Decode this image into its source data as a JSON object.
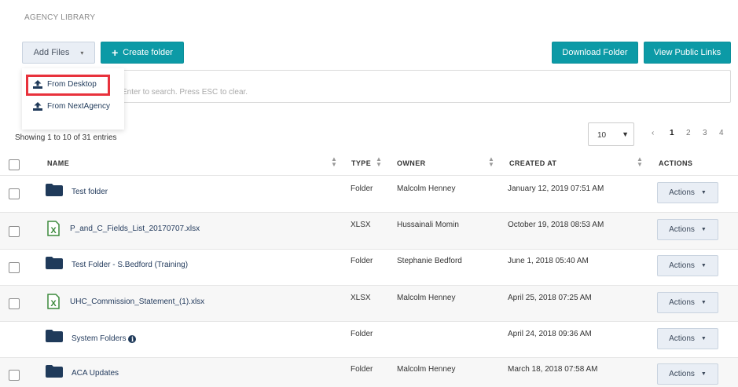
{
  "header": {
    "title": "AGENCY LIBRARY"
  },
  "toolbar": {
    "add_files_label": "Add Files",
    "create_folder_label": "Create folder",
    "download_folder_label": "Download Folder",
    "view_public_links_label": "View Public Links"
  },
  "add_files_menu": {
    "items": [
      {
        "label": "From Desktop",
        "icon": "upload-icon"
      },
      {
        "label": "From NextAgency",
        "icon": "upload-icon"
      }
    ]
  },
  "search": {
    "placeholder": "Enter to search. Press ESC to clear."
  },
  "table_info": {
    "showing": "Showing 1 to 10 of 31 entries",
    "page_size": "10"
  },
  "pagination": {
    "prev": "‹",
    "pages": [
      "1",
      "2",
      "3",
      "4"
    ],
    "current": "1"
  },
  "table": {
    "columns": [
      "NAME",
      "TYPE",
      "OWNER",
      "CREATED AT",
      "ACTIONS"
    ],
    "action_label": "Actions",
    "rows": [
      {
        "name": "Test folder",
        "type": "Folder",
        "owner": "Malcolm Henney",
        "created_at": "January 12, 2019 07:51 AM",
        "icon": "folder-icon"
      },
      {
        "name": "P_and_C_Fields_List_20170707.xlsx",
        "type": "XLSX",
        "owner": "Hussainali Momin",
        "created_at": "October 19, 2018 08:53 AM",
        "icon": "xlsx-icon"
      },
      {
        "name": "Test Folder - S.Bedford (Training)",
        "type": "Folder",
        "owner": "Stephanie Bedford",
        "created_at": "June 1, 2018 05:40 AM",
        "icon": "folder-icon"
      },
      {
        "name": "UHC_Commission_Statement_(1).xlsx",
        "type": "XLSX",
        "owner": "Malcolm Henney",
        "created_at": "April 25, 2018 07:25 AM",
        "icon": "xlsx-icon"
      },
      {
        "name": "System Folders",
        "type": "Folder",
        "owner": "",
        "created_at": "April 24, 2018 09:36 AM",
        "icon": "folder-icon"
      },
      {
        "name": "ACA Updates",
        "type": "Folder",
        "owner": "Malcolm Henney",
        "created_at": "March 18, 2018 07:58 AM",
        "icon": "folder-icon"
      }
    ]
  },
  "colors": {
    "teal": "#0c9aa6",
    "navy": "#1f3a5a",
    "highlight_red": "#e8323c",
    "xlsx_green": "#3c8a3c"
  }
}
